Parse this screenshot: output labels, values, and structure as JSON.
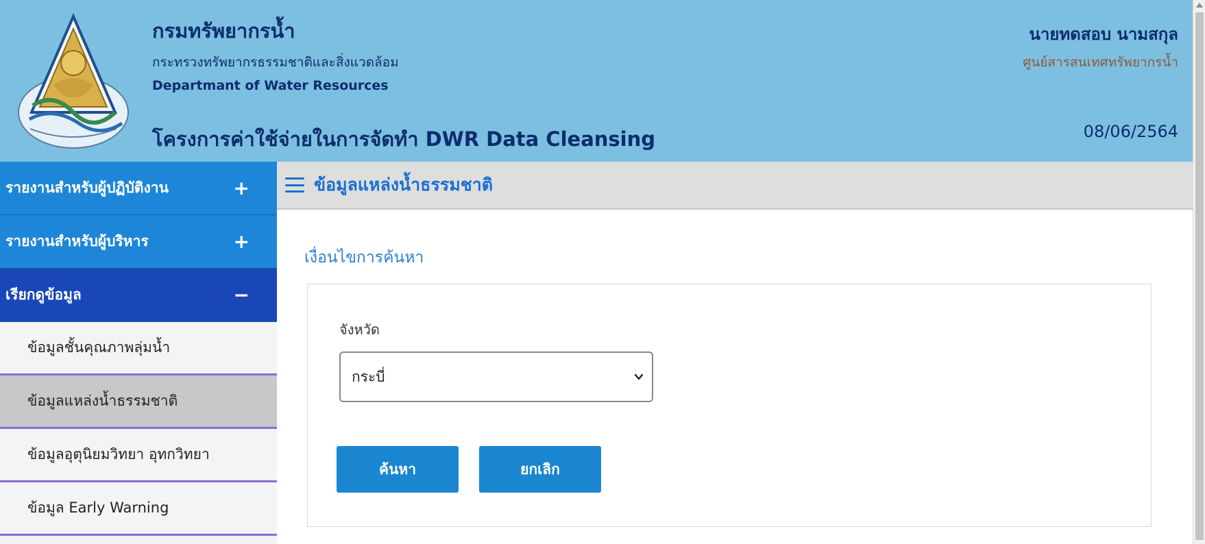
{
  "header": {
    "org_name_th": "กรมทรัพยากรน้ำ",
    "ministry_th": "กระทรวงทรัพยากรธรรมชาติและสิ่งแวดล้อม",
    "org_name_en": "Departmant of Water Resources",
    "project_title": "โครงการค่าใช้จ่ายในการจัดทำ DWR Data Cleansing",
    "user_name": "นายทดสอบ นามสกุล",
    "user_department": "ศูนย์สารสนเทศทรัพยากรน้ำ",
    "date": "08/06/2564",
    "logo_icon": "dwr-emblem-icon"
  },
  "sidebar": {
    "groups": [
      {
        "label": "รายงานสำหรับผู้ปฏิบัติงาน",
        "sign": "+"
      },
      {
        "label": "รายงานสำหรับผู้บริหาร",
        "sign": "+"
      },
      {
        "label": "เรียกดูข้อมูล",
        "sign": "−"
      }
    ],
    "items": [
      {
        "label": "ข้อมูลชั้นคุณภาพลุ่มน้ำ"
      },
      {
        "label": "ข้อมูลแหล่งน้ำธรรมชาติ"
      },
      {
        "label": "ข้อมูลอุตุนิยมวิทยา อุทกวิทยา"
      },
      {
        "label": "ข้อมูล Early Warning"
      }
    ]
  },
  "main": {
    "page_title": "ข้อมูลแหล่งน้ำธรรมชาติ",
    "section_title": "เงื่อนไขการค้นหา",
    "province_label": "จังหวัด",
    "province_value": "กระบี่",
    "search_button": "ค้นหา",
    "cancel_button": "ยกเลิก"
  },
  "colors": {
    "header_bg": "#7dbfe0",
    "sidebar_group": "#1e86d8",
    "sidebar_group_active": "#1a47b8",
    "accent": "#1a6fd0",
    "button": "#1a86cf",
    "item_divider": "#8a6bd6"
  }
}
